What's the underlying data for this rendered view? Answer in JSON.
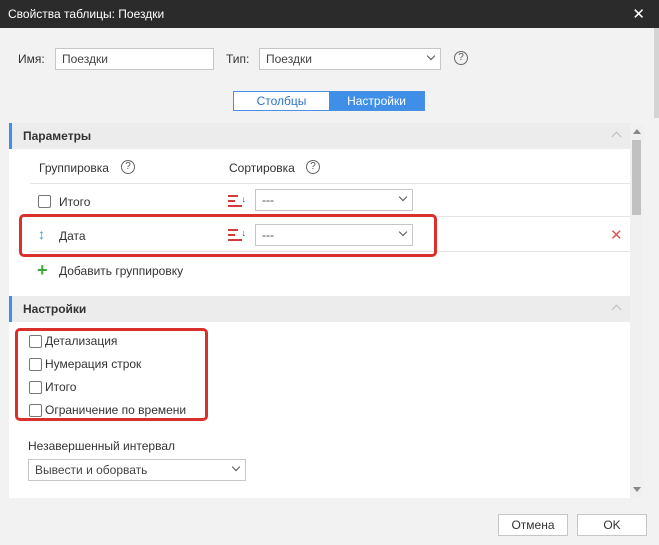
{
  "window": {
    "title": "Свойства таблицы: Поездки"
  },
  "header": {
    "name_label": "Имя:",
    "name_value": "Поездки",
    "type_label": "Тип:",
    "type_value": "Поездки"
  },
  "tabs": [
    {
      "label": "Столбцы",
      "active": false
    },
    {
      "label": "Настройки",
      "active": true
    }
  ],
  "parameters": {
    "title": "Параметры",
    "grouping_header": "Группировка",
    "sorting_header": "Сортировка",
    "rows": [
      {
        "label": "Итого",
        "sort_value": "---"
      },
      {
        "label": "Дата",
        "sort_value": "---"
      }
    ],
    "add_grouping": "Добавить группировку"
  },
  "settings": {
    "title": "Настройки",
    "options": [
      {
        "label": "Детализация",
        "checked": false
      },
      {
        "label": "Нумерация строк",
        "checked": false
      },
      {
        "label": "Итого",
        "checked": false
      },
      {
        "label": "Ограничение по времени",
        "checked": false
      }
    ],
    "incomplete_interval_label": "Незавершенный интервал",
    "incomplete_interval_value": "Вывести и оборвать"
  },
  "footer": {
    "cancel_label": "Отмена",
    "ok_label": "OK"
  },
  "colors": {
    "accent": "#3f8fe8",
    "highlight": "#d9302b",
    "titlebar": "#2b2b2b",
    "add": "#3aa73a"
  }
}
